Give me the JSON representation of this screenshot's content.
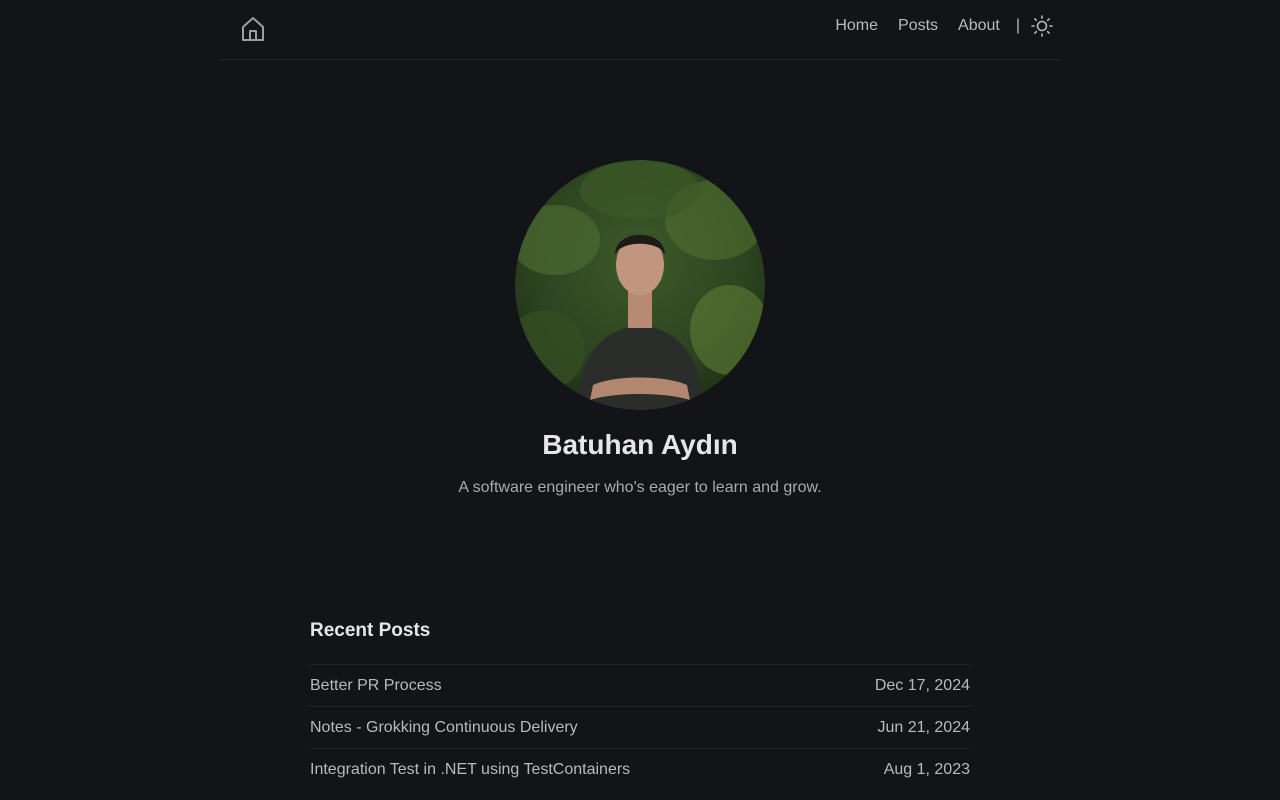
{
  "header": {
    "home_icon": "home-icon",
    "nav": [
      {
        "label": "Home"
      },
      {
        "label": "Posts"
      },
      {
        "label": "About"
      }
    ],
    "separator": "|",
    "theme_icon": "sun-icon"
  },
  "profile": {
    "name": "Batuhan Aydın",
    "tagline": "A software engineer who's eager to learn and grow."
  },
  "recent_posts": {
    "title": "Recent Posts",
    "items": [
      {
        "title": "Better PR Process",
        "date": "Dec 17, 2024"
      },
      {
        "title": "Notes - Grokking Continuous Delivery",
        "date": "Jun 21, 2024"
      },
      {
        "title": "Integration Test in .NET using TestContainers",
        "date": "Aug 1, 2023"
      }
    ]
  },
  "colors": {
    "background": "#131418",
    "text": "#b9babd",
    "heading": "#e6e6e8",
    "divider": "#24262b"
  }
}
